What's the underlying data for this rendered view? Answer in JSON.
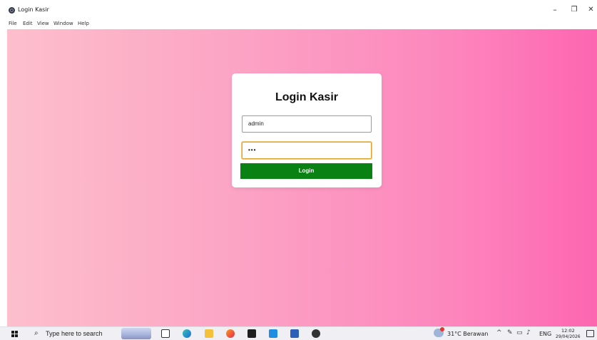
{
  "window": {
    "title": "Login Kasir",
    "controls": {
      "minimize": "–",
      "maximize": "❐",
      "close": "✕"
    }
  },
  "menu": {
    "items": [
      "File",
      "Edit",
      "View",
      "Window",
      "Help"
    ]
  },
  "login": {
    "heading": "Login Kasir",
    "username_value": "admin",
    "password_value": "•••",
    "button_label": "Login"
  },
  "colors": {
    "gradient_start": "#fdbfcc",
    "gradient_end": "#fd66b1",
    "button": "#0a8113",
    "focus_border": "#e0a62b"
  },
  "taskbar": {
    "search_placeholder": "Type here to search",
    "icons": [
      "start-icon",
      "search-icon",
      "task-view-icon",
      "edge-icon",
      "file-explorer-icon",
      "firefox-icon",
      "terminal-icon",
      "vscode-icon",
      "word-icon",
      "app-icon"
    ],
    "weather": "31°C  Berawan",
    "language": "ENG",
    "time": "12:02",
    "date": "29/04/2026"
  }
}
